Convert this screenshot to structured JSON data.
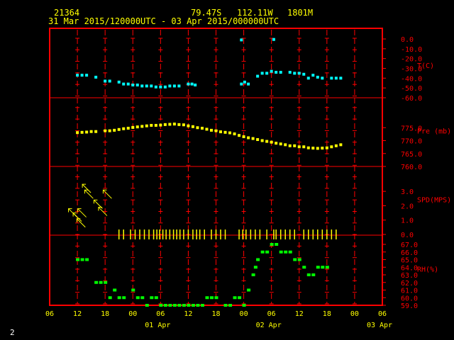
{
  "header": {
    "station": "21364",
    "lat": "79.47S",
    "lon": "112.11W",
    "elev": "1801M",
    "period": "31 Mar 2015/120000UTC - 03 Apr 2015/000000UTC"
  },
  "page_number": "2",
  "colors": {
    "frame": "#ff0000",
    "temp": "#00ffff",
    "pres": "#ffff00",
    "wind": "#ffff00",
    "rh": "#00ff00",
    "text": "#ffff00"
  },
  "chart_data": {
    "type": "scatter",
    "x_unit": "hours since 31 Mar 06 UTC",
    "xlim": [
      0,
      72
    ],
    "x_tick_labels": [
      "06",
      "12",
      "18",
      "00",
      "06",
      "12",
      "18",
      "00",
      "06",
      "12",
      "18",
      "00",
      "06"
    ],
    "date_labels": [
      "01 Apr",
      "02 Apr",
      "03 Apr"
    ],
    "panels": [
      {
        "name": "temp",
        "label": "T(C)",
        "ylim": [
          -60,
          0
        ],
        "tick_labels": [
          "0.0",
          "-10.0",
          "-20.0",
          "-30.0",
          "-40.0",
          "-50.0",
          "-60.0"
        ],
        "tick_values": [
          0,
          -10,
          -20,
          -30,
          -40,
          -50,
          -60
        ],
        "points": [
          [
            6,
            -37
          ],
          [
            7,
            -37
          ],
          [
            8,
            -37
          ],
          [
            10,
            -39
          ],
          [
            12,
            -43
          ],
          [
            13,
            -43
          ],
          [
            15,
            -44
          ],
          [
            16,
            -46
          ],
          [
            17,
            -46
          ],
          [
            18,
            -47
          ],
          [
            19,
            -47
          ],
          [
            20,
            -48
          ],
          [
            21,
            -48
          ],
          [
            22,
            -48
          ],
          [
            23,
            -49
          ],
          [
            24,
            -49
          ],
          [
            25,
            -49
          ],
          [
            26,
            -48
          ],
          [
            27,
            -48
          ],
          [
            28,
            -48
          ],
          [
            30,
            -46
          ],
          [
            30.8,
            -46
          ],
          [
            31.5,
            -47
          ],
          [
            41.5,
            -46
          ],
          [
            42.2,
            -44
          ],
          [
            43,
            -46
          ],
          [
            45,
            -38
          ],
          [
            46,
            -35
          ],
          [
            47,
            -35
          ],
          [
            48,
            -33
          ],
          [
            49,
            -34
          ],
          [
            50,
            -34
          ],
          [
            52,
            -34
          ],
          [
            53,
            -35
          ],
          [
            54,
            -35
          ],
          [
            55,
            -36
          ],
          [
            56,
            -40
          ],
          [
            57,
            -37
          ],
          [
            58,
            -39
          ],
          [
            59,
            -40
          ],
          [
            61,
            -40
          ],
          [
            62,
            -40
          ],
          [
            63,
            -40
          ]
        ],
        "outliers": [
          [
            41.5,
            -1
          ],
          [
            48.5,
            -0.5
          ]
        ]
      },
      {
        "name": "pres",
        "label": "Pre (mb)",
        "ylim": [
          760,
          780
        ],
        "tick_labels": [
          "775.0",
          "770.0",
          "765.0",
          "760.0"
        ],
        "tick_values": [
          775,
          770,
          765,
          760
        ],
        "points": [
          [
            6,
            773.1
          ],
          [
            7,
            773.2
          ],
          [
            8,
            773.3
          ],
          [
            9,
            773.5
          ],
          [
            10,
            773.5
          ],
          [
            12,
            773.8
          ],
          [
            13,
            773.8
          ],
          [
            14,
            774.0
          ],
          [
            15,
            774.3
          ],
          [
            16,
            774.6
          ],
          [
            17,
            774.8
          ],
          [
            18,
            775.1
          ],
          [
            19,
            775.3
          ],
          [
            20,
            775.5
          ],
          [
            21,
            775.7
          ],
          [
            22,
            775.9
          ],
          [
            23,
            775.9
          ],
          [
            24,
            776.0
          ],
          [
            25,
            776.2
          ],
          [
            26,
            776.3
          ],
          [
            27,
            776.4
          ],
          [
            28,
            776.2
          ],
          [
            29,
            776.1
          ],
          [
            30,
            775.7
          ],
          [
            31,
            775.4
          ],
          [
            32,
            775.0
          ],
          [
            33,
            774.8
          ],
          [
            34,
            774.4
          ],
          [
            35,
            774.0
          ],
          [
            36,
            773.8
          ],
          [
            37,
            773.4
          ],
          [
            38,
            773.2
          ],
          [
            39,
            773.0
          ],
          [
            40,
            772.6
          ],
          [
            41,
            772.0
          ],
          [
            42,
            771.5
          ],
          [
            43,
            771.1
          ],
          [
            44,
            770.8
          ],
          [
            45,
            770.4
          ],
          [
            46,
            770.0
          ],
          [
            47,
            769.7
          ],
          [
            48,
            769.4
          ],
          [
            49,
            769.0
          ],
          [
            50,
            768.7
          ],
          [
            51,
            768.4
          ],
          [
            52,
            768.0
          ],
          [
            53,
            768.0
          ],
          [
            54,
            767.6
          ],
          [
            55,
            767.6
          ],
          [
            56,
            767.2
          ],
          [
            57,
            767.1
          ],
          [
            58,
            767.0
          ],
          [
            59,
            767.1
          ],
          [
            60,
            767.2
          ],
          [
            61,
            767.6
          ],
          [
            62,
            768.0
          ],
          [
            63,
            768.4
          ]
        ]
      },
      {
        "name": "wind",
        "label": "SPD(MPS)",
        "ylim": [
          0,
          3.5
        ],
        "tick_labels": [
          "3.0",
          "2.0",
          "1.0",
          "0.0"
        ],
        "tick_values": [
          3,
          2,
          1,
          0
        ],
        "arrows": [
          [
            5,
            1.5
          ],
          [
            6,
            1.2
          ],
          [
            6.8,
            0.8
          ],
          [
            7,
            1.5
          ],
          [
            8,
            3.2
          ],
          [
            8.5,
            2.8
          ],
          [
            10.5,
            2.1
          ],
          [
            11.5,
            1.6
          ],
          [
            12.5,
            2.8
          ]
        ],
        "calm_ticks": [
          15,
          16,
          17.5,
          18.5,
          19.5,
          20.5,
          21.5,
          22.5,
          23.2,
          23.8,
          24.5,
          25.2,
          26,
          26.8,
          27.5,
          28.2,
          29,
          30,
          31,
          31.8,
          32.5,
          33.5,
          35,
          36,
          37,
          38,
          41,
          41.8,
          42.5,
          43.5,
          44.5,
          45.5,
          47,
          48.5,
          49,
          50,
          51,
          52,
          53,
          55,
          56,
          57,
          58,
          59,
          60,
          61,
          62
        ]
      },
      {
        "name": "rh",
        "label": "RH(%)",
        "ylim": [
          59,
          67
        ],
        "tick_labels": [
          "67.0",
          "66.0",
          "65.0",
          "64.0",
          "63.0",
          "62.0",
          "61.0",
          "60.0",
          "59.0"
        ],
        "tick_values": [
          67,
          66,
          65,
          64,
          63,
          62,
          61,
          60,
          59
        ],
        "points": [
          [
            6,
            65
          ],
          [
            7,
            65
          ],
          [
            8,
            65
          ],
          [
            10,
            62
          ],
          [
            11,
            62
          ],
          [
            12,
            62
          ],
          [
            13,
            60
          ],
          [
            14,
            61
          ],
          [
            15,
            60
          ],
          [
            16,
            60
          ],
          [
            18,
            61
          ],
          [
            19,
            60
          ],
          [
            20,
            60
          ],
          [
            21,
            59
          ],
          [
            22,
            60
          ],
          [
            23,
            60
          ],
          [
            24,
            59
          ],
          [
            25,
            59
          ],
          [
            26,
            59
          ],
          [
            27,
            59
          ],
          [
            28,
            59
          ],
          [
            29,
            59
          ],
          [
            30,
            59
          ],
          [
            31,
            59
          ],
          [
            32,
            59
          ],
          [
            33,
            59
          ],
          [
            34,
            60
          ],
          [
            35,
            60
          ],
          [
            36,
            60
          ],
          [
            38,
            59
          ],
          [
            39,
            59
          ],
          [
            40,
            60
          ],
          [
            41,
            60
          ],
          [
            42,
            59
          ],
          [
            43,
            61
          ],
          [
            44,
            63
          ],
          [
            44.5,
            64
          ],
          [
            45,
            65
          ],
          [
            46,
            66
          ],
          [
            47,
            66
          ],
          [
            48,
            67
          ],
          [
            49,
            67
          ],
          [
            50,
            66
          ],
          [
            51,
            66
          ],
          [
            52,
            66
          ],
          [
            53,
            65
          ],
          [
            54,
            65
          ],
          [
            55,
            64
          ],
          [
            56,
            63
          ],
          [
            57,
            63
          ],
          [
            58,
            64
          ],
          [
            59,
            64
          ],
          [
            60,
            64
          ]
        ]
      }
    ]
  }
}
